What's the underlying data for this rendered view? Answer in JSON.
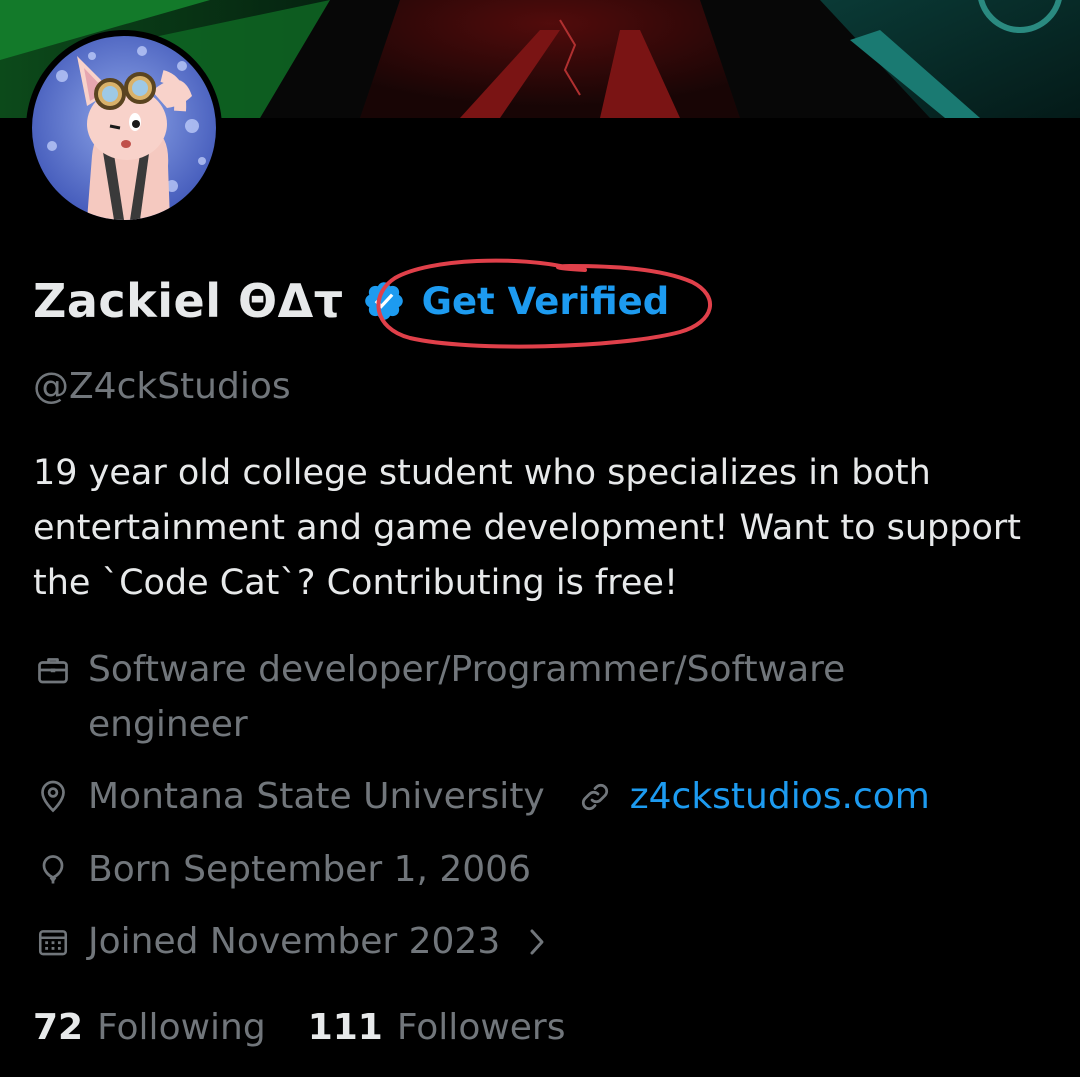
{
  "profile": {
    "display_name": "Zackiel ΘΔτ",
    "get_verified_label": "Get Verified",
    "handle": "@Z4ckStudios",
    "bio": "19 year old college student who specializes in both entertainment and game development! Want to support the `Code Cat`? Contributing is free!",
    "occupation": "Software developer/Programmer/Software engineer",
    "location": "Montana State University",
    "website": "z4ckstudios.com",
    "birthday": "Born September 1, 2006",
    "joined": "Joined November 2023",
    "following_count": "72",
    "following_label": "Following",
    "followers_count": "111",
    "followers_label": "Followers"
  },
  "icons": {
    "verified": "verified-badge-icon",
    "occupation": "briefcase-icon",
    "location": "location-pin-icon",
    "website": "link-icon",
    "birthday": "balloon-icon",
    "joined": "calendar-icon",
    "expand": "chevron-right-icon"
  },
  "colors": {
    "background": "#000000",
    "primary_text": "#e7e9ea",
    "secondary_text": "#71767b",
    "accent_blue": "#1d9bf0",
    "annotation_red": "#e0404a"
  }
}
